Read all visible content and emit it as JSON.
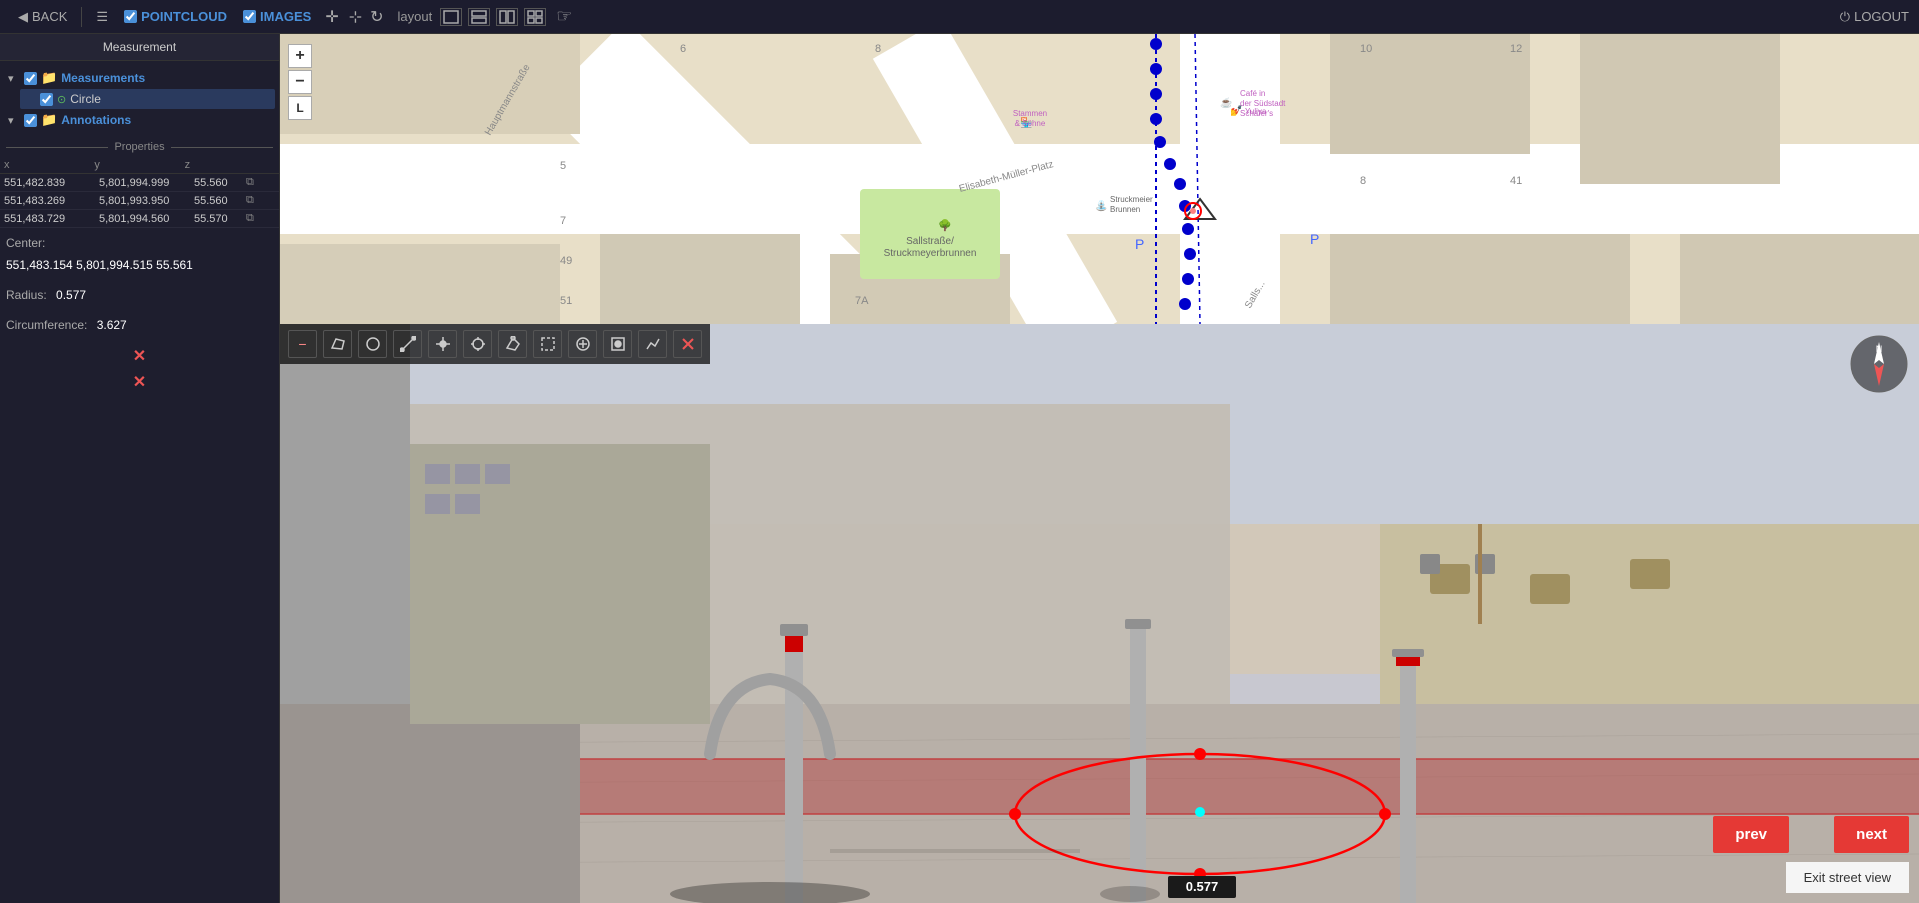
{
  "topbar": {
    "back_label": "BACK",
    "pointcloud_label": "POINTCLOUD",
    "images_label": "IMAGES",
    "layout_label": "layout",
    "logout_label": "LOGOUT"
  },
  "left_panel": {
    "measurement_title": "Measurement",
    "tree": {
      "measurements_label": "Measurements",
      "circle_label": "Circle",
      "annotations_label": "Annotations"
    },
    "properties": {
      "title": "Properties",
      "columns": {
        "x": "x",
        "y": "y",
        "z": "z"
      },
      "rows": [
        {
          "x": "551,482.839",
          "y": "5,801,994.999",
          "z": "55.560"
        },
        {
          "x": "551,483.269",
          "y": "5,801,993.950",
          "z": "55.560"
        },
        {
          "x": "551,483.729",
          "y": "5,801,994.560",
          "z": "55.570"
        }
      ],
      "center_label": "Center:",
      "center_value": "551,483.154  5,801,994.515  55.561",
      "radius_label": "Radius:",
      "radius_value": "0.577",
      "circumference_label": "Circumference:",
      "circumference_value": "3.627"
    }
  },
  "sv_toolbar": {
    "minus_btn": "−",
    "tools": [
      "polygon",
      "circle",
      "line",
      "point",
      "crosshair",
      "edit-polygon",
      "select",
      "area",
      "target",
      "graph",
      "close"
    ]
  },
  "street_view": {
    "measurement_label": "0.577",
    "prev_btn": "prev",
    "next_btn": "next",
    "exit_btn": "Exit street view"
  }
}
